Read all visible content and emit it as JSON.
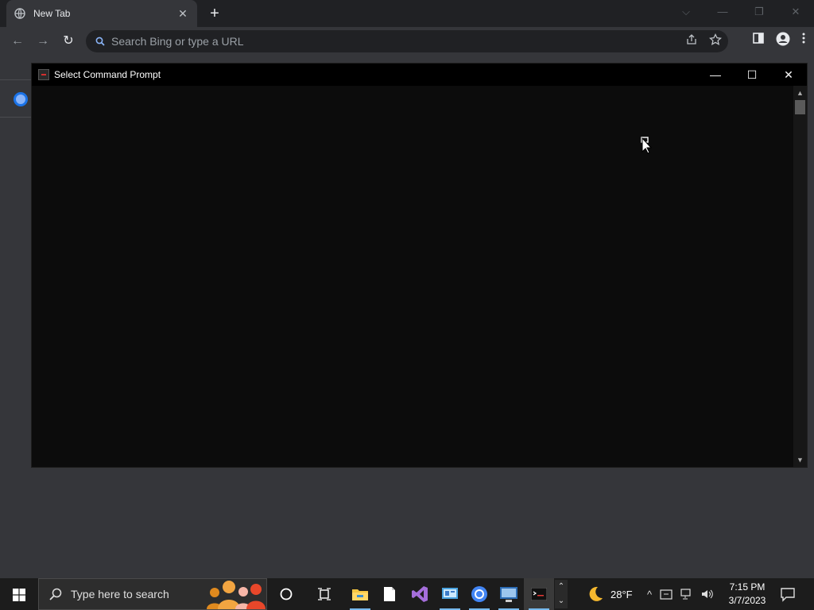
{
  "browser": {
    "tab_title": "New Tab",
    "tab_close": "✕",
    "new_tab": "+",
    "window_controls": {
      "dropdown": "⌵",
      "minimize": "—",
      "restore": "❐",
      "close": "✕"
    },
    "nav": {
      "back": "←",
      "forward": "→",
      "reload": "↻"
    },
    "omnibox_placeholder": "Search Bing or type a URL"
  },
  "cmd_window": {
    "title": "Select Command Prompt",
    "minimize": "—",
    "maximize": "☐",
    "close": "✕",
    "scroll_up": "▲",
    "scroll_down": "▼"
  },
  "taskbar": {
    "search_placeholder": "Type here to search",
    "weather_temp": "28°F",
    "time": "7:15 PM",
    "date": "3/7/2023",
    "scroll_up": "⌃",
    "scroll_down": "⌄",
    "tray_chevron": "^",
    "colors": {
      "accent": "#76b9ed",
      "taskbar": "#1c1c1c"
    }
  }
}
